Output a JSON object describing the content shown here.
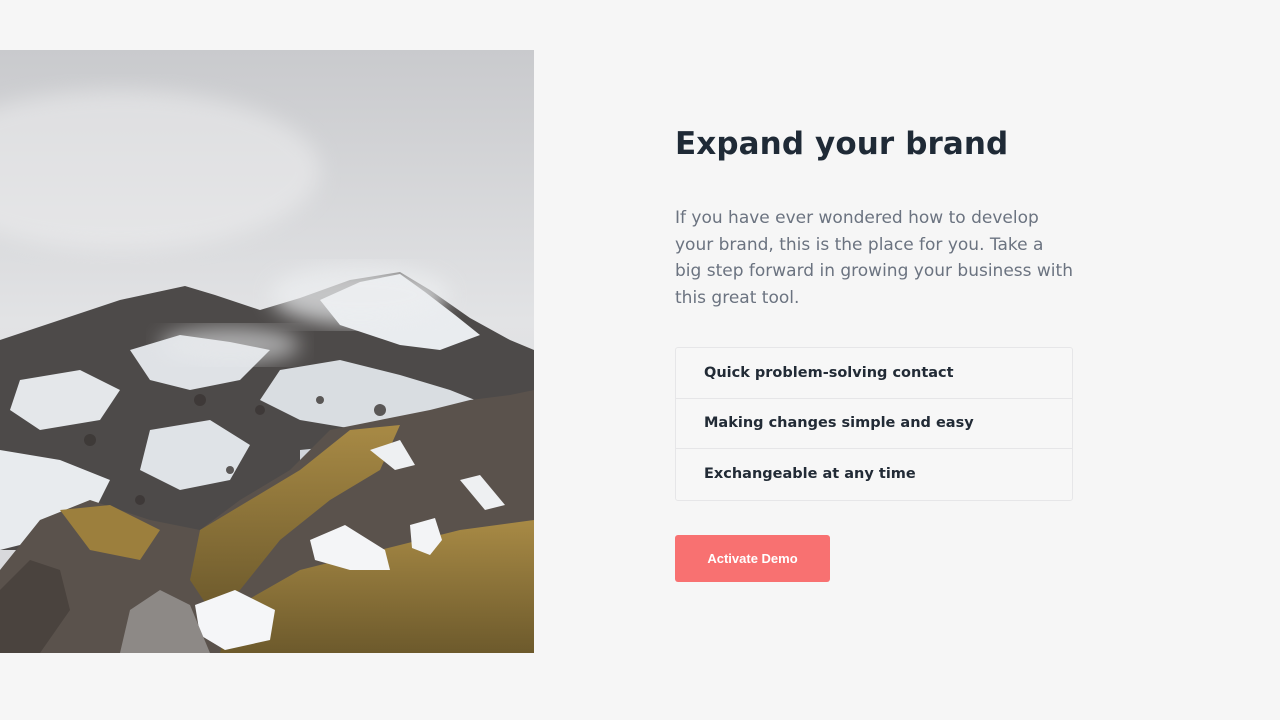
{
  "hero": {
    "image_description": "snowy-mountain-photo"
  },
  "section": {
    "title": "Expand your brand",
    "description": "If you have ever wondered how to develop your brand, this is the place for you. Take a big step forward in growing your business with this great tool.",
    "features": [
      {
        "label": "Quick problem-solving contact"
      },
      {
        "label": "Making changes simple and easy"
      },
      {
        "label": "Exchangeable at any time"
      }
    ],
    "cta_label": "Activate Demo"
  },
  "colors": {
    "background": "#f6f6f6",
    "heading": "#1f2a36",
    "body_text": "#6b7380",
    "accent": "#f87171",
    "border": "#e6e6e8"
  }
}
